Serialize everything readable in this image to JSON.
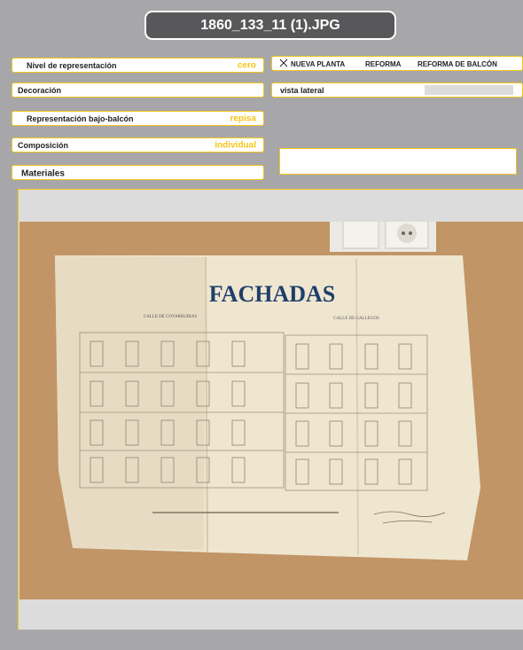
{
  "header": {
    "filename": "1860_133_11 (1).JPG"
  },
  "fields": {
    "nivel": {
      "label": "Nivel de representación",
      "value": "cero"
    },
    "decoracion": {
      "label": "Decoración"
    },
    "bajo_balcon": {
      "label": "Representación bajo-balcón",
      "value": "repisa"
    },
    "composicion": {
      "label": "Composición",
      "value": "individual"
    },
    "materiales": {
      "label": "Materiales"
    }
  },
  "options": {
    "marker": "close-icon",
    "items": [
      "NUEVA PLANTA",
      "REFORMA",
      "REFORMA DE BALCÓN"
    ]
  },
  "vista": {
    "label": "vista lateral"
  },
  "photo": {
    "heading": "FACHADAS",
    "subtitle_left": "CALLE DE COVARRUBIAS",
    "subtitle_right": "CALLE DE GALLEGOS"
  },
  "colors": {
    "accent": "#f5c518",
    "background": "#a7a7a9",
    "title_bg": "#58585a"
  }
}
